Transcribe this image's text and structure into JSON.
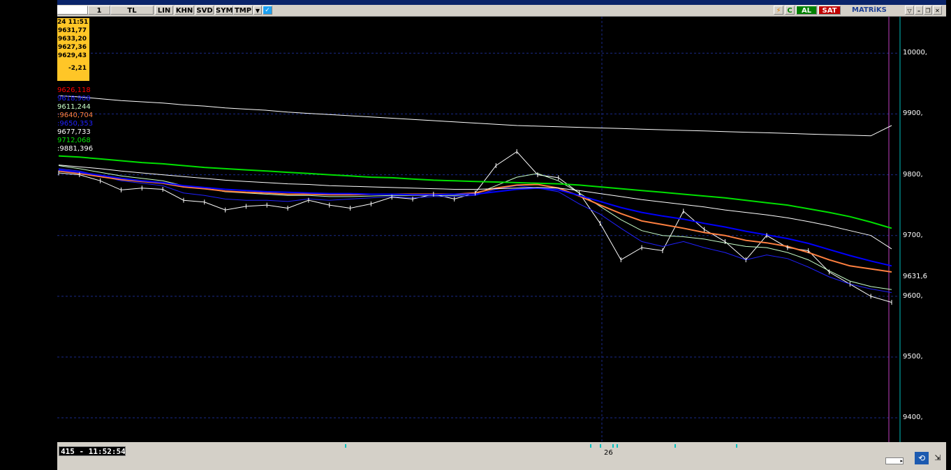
{
  "toolbar": {
    "field_value": "1",
    "currency": "TL",
    "buttons": [
      "LIN",
      "KHN",
      "SVD",
      "SYM",
      "TMP"
    ],
    "al_label": "AL",
    "sat_label": "SAT",
    "brand": "MATRiKS"
  },
  "ohlc_box": {
    "time": "24 11:51",
    "values": [
      "9631,77",
      "9633,20",
      "9627,36",
      "9629,43"
    ],
    "change": "-2,21"
  },
  "legend": [
    {
      "text": "9626,118",
      "color": "#ff0000"
    },
    {
      "text": "9618,908",
      "color": "#2020ff"
    },
    {
      "text": "9611,244",
      "color": "#c8ffc8"
    },
    {
      "text": ":9640,704",
      "color": "#ff8040"
    },
    {
      "text": ":9650,353",
      "color": "#2020ff"
    },
    {
      "text": "9677,733",
      "color": "#ffffff"
    },
    {
      "text": "9712,068",
      "color": "#00e000"
    },
    {
      "text": ":9881,396",
      "color": "#ffffff"
    }
  ],
  "y_axis": {
    "ticks": [
      {
        "value": 10000,
        "label": "10000,"
      },
      {
        "value": 9900,
        "label": "9900,"
      },
      {
        "value": 9800,
        "label": "9800,"
      },
      {
        "value": 9700,
        "label": "9700,"
      },
      {
        "value": 9600,
        "label": "9600,"
      },
      {
        "value": 9500,
        "label": "9500,"
      },
      {
        "value": 9400,
        "label": "9400,"
      }
    ],
    "last_price_label": "9631,6",
    "last_price": 9631.6
  },
  "x_axis": {
    "day_label": "26"
  },
  "status": {
    "timestamp": "415 - 11:52:54"
  },
  "chart_data": {
    "type": "line",
    "x": [
      0,
      5,
      10,
      15,
      20,
      25,
      30,
      35,
      40,
      45,
      50,
      55,
      60,
      65,
      70,
      75,
      80,
      85,
      90,
      95,
      100,
      105,
      110,
      115,
      120,
      125,
      130,
      135,
      140,
      145,
      150,
      155,
      160,
      165,
      170,
      175,
      180,
      185,
      190,
      195,
      200
    ],
    "series": [
      {
        "color": "#ffffff",
        "values": [
          9803,
          9800,
          9790,
          9775,
          9778,
          9776,
          9758,
          9755,
          9742,
          9748,
          9750,
          9745,
          9758,
          9750,
          9745,
          9752,
          9763,
          9760,
          9768,
          9760,
          9770,
          9815,
          9838,
          9800,
          9795,
          9770,
          9720,
          9660,
          9680,
          9675,
          9740,
          9710,
          9690,
          9660,
          9700,
          9680,
          9675,
          9640,
          9620,
          9600,
          9590
        ]
      },
      {
        "color": "#2020ff",
        "values": [
          9810,
          9806,
          9798,
          9790,
          9786,
          9782,
          9770,
          9766,
          9760,
          9758,
          9758,
          9756,
          9760,
          9758,
          9760,
          9762,
          9764,
          9762,
          9764,
          9764,
          9766,
          9776,
          9782,
          9778,
          9772,
          9752,
          9735,
          9712,
          9690,
          9682,
          9690,
          9680,
          9672,
          9660,
          9668,
          9662,
          9648,
          9632,
          9620,
          9612,
          9606
        ]
      },
      {
        "color": "#c8ffc8",
        "values": [
          9815,
          9810,
          9804,
          9798,
          9794,
          9790,
          9782,
          9778,
          9772,
          9770,
          9768,
          9766,
          9766,
          9764,
          9764,
          9765,
          9766,
          9766,
          9766,
          9766,
          9768,
          9782,
          9796,
          9802,
          9790,
          9770,
          9748,
          9726,
          9708,
          9700,
          9698,
          9694,
          9688,
          9682,
          9680,
          9672,
          9660,
          9642,
          9625,
          9616,
          9611
        ]
      },
      {
        "color": "#ff8040",
        "values": [
          9806,
          9802,
          9797,
          9792,
          9789,
          9786,
          9780,
          9777,
          9773,
          9771,
          9770,
          9768,
          9768,
          9767,
          9767,
          9768,
          9768,
          9768,
          9768,
          9768,
          9770,
          9778,
          9783,
          9784,
          9778,
          9765,
          9750,
          9736,
          9724,
          9718,
          9712,
          9705,
          9700,
          9692,
          9688,
          9682,
          9672,
          9660,
          9650,
          9645,
          9640
        ]
      },
      {
        "color": "#0000ff",
        "values": [
          9808,
          9804,
          9799,
          9794,
          9790,
          9787,
          9782,
          9779,
          9776,
          9774,
          9772,
          9771,
          9770,
          9769,
          9769,
          9768,
          9768,
          9767,
          9767,
          9768,
          9768,
          9772,
          9776,
          9778,
          9775,
          9766,
          9756,
          9746,
          9738,
          9732,
          9727,
          9720,
          9714,
          9707,
          9701,
          9695,
          9687,
          9677,
          9667,
          9658,
          9650
        ]
      },
      {
        "color": "#ffffff",
        "values": [
          9816,
          9813,
          9810,
          9806,
          9803,
          9800,
          9797,
          9794,
          9791,
          9789,
          9787,
          9785,
          9784,
          9782,
          9781,
          9780,
          9779,
          9778,
          9777,
          9776,
          9776,
          9777,
          9778,
          9779,
          9778,
          9774,
          9769,
          9764,
          9759,
          9755,
          9751,
          9747,
          9742,
          9738,
          9734,
          9729,
          9723,
          9716,
          9708,
          9700,
          9678
        ]
      },
      {
        "color": "#00e000",
        "values": [
          9831,
          9829,
          9826,
          9823,
          9820,
          9818,
          9815,
          9812,
          9810,
          9808,
          9806,
          9804,
          9802,
          9800,
          9798,
          9796,
          9795,
          9793,
          9791,
          9790,
          9789,
          9788,
          9787,
          9786,
          9785,
          9783,
          9780,
          9777,
          9774,
          9771,
          9768,
          9765,
          9762,
          9758,
          9754,
          9750,
          9744,
          9738,
          9731,
          9722,
          9712
        ]
      },
      {
        "color": "#ffffff",
        "values": [
          9930,
          9928,
          9925,
          9922,
          9920,
          9918,
          9915,
          9913,
          9910,
          9908,
          9906,
          9903,
          9901,
          9899,
          9897,
          9895,
          9893,
          9891,
          9889,
          9887,
          9885,
          9883,
          9881,
          9880,
          9879,
          9878,
          9877,
          9876,
          9875,
          9874,
          9873,
          9872,
          9871,
          9870,
          9869,
          9868,
          9867,
          9866,
          9865,
          9864,
          9881
        ]
      }
    ],
    "ylim": [
      9360,
      10060
    ]
  }
}
